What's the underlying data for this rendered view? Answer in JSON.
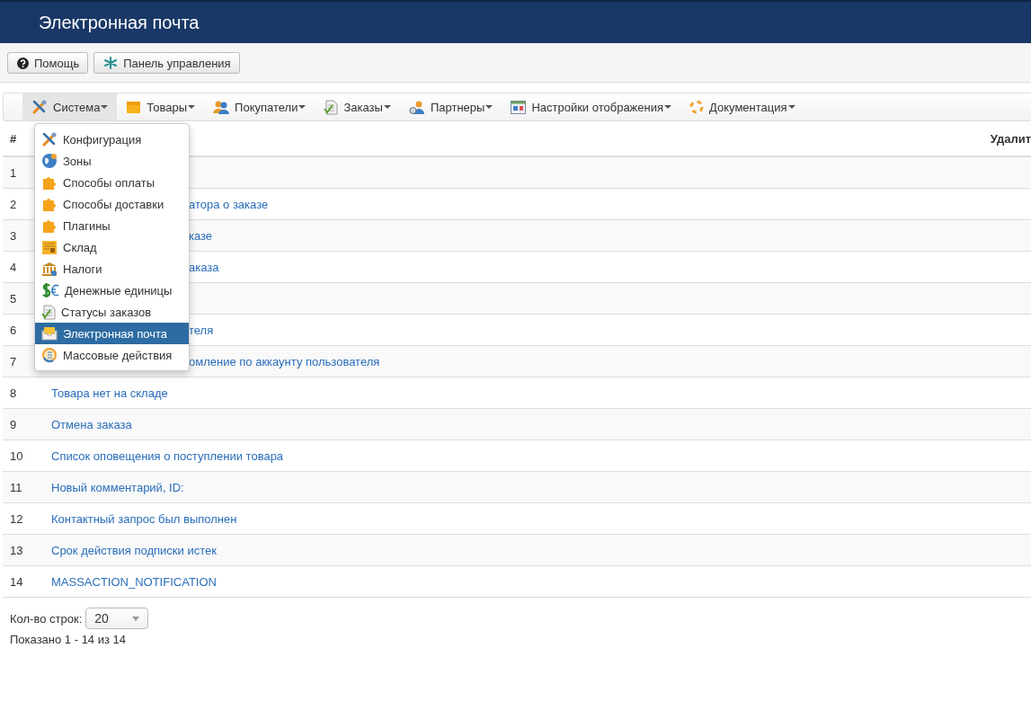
{
  "header": {
    "title": "Электронная почта"
  },
  "toolbar": [
    {
      "label": "Помощь"
    },
    {
      "label": "Панель управления"
    }
  ],
  "menu": [
    {
      "label": "Система",
      "selected": true
    },
    {
      "label": "Товары",
      "selected": false
    },
    {
      "label": "Покупатели",
      "selected": false
    },
    {
      "label": "Заказы",
      "selected": false
    },
    {
      "label": "Партнеры",
      "selected": false
    },
    {
      "label": "Настройки отображения",
      "selected": false
    },
    {
      "label": "Документация",
      "selected": false
    }
  ],
  "dropdown": [
    {
      "label": "Конфигурация",
      "selected": false
    },
    {
      "label": "Зоны",
      "selected": false
    },
    {
      "label": "Способы оплаты",
      "selected": false
    },
    {
      "label": "Способы доставки",
      "selected": false
    },
    {
      "label": "Плагины",
      "selected": false
    },
    {
      "label": "Склад",
      "selected": false
    },
    {
      "label": "Налоги",
      "selected": false
    },
    {
      "label": "Денежные единицы",
      "selected": false
    },
    {
      "label": "Статусы заказов",
      "selected": false
    },
    {
      "label": "Электронная почта",
      "selected": true
    },
    {
      "label": "Массовые действия",
      "selected": false
    }
  ],
  "table": {
    "columns": [
      "#",
      "Удалит"
    ],
    "rows": [
      {
        "number": "1"
      },
      {
        "number": "2",
        "title": "атора о заказе"
      },
      {
        "number": "3",
        "title": "казе"
      },
      {
        "number": "4",
        "title": "аказа"
      },
      {
        "number": "5"
      },
      {
        "number": "6",
        "title": "теля"
      },
      {
        "number": "7",
        "title": "омление по аккаунту пользователя"
      },
      {
        "number": "8",
        "title": "Товара нет на складе"
      },
      {
        "number": "9",
        "title": "Отмена заказа"
      },
      {
        "number": "10",
        "title": "Список оповещения о поступлении товара"
      },
      {
        "number": "11",
        "title": "Новый комментарий, ID:"
      },
      {
        "number": "12",
        "title": "Контактный запрос был выполнен"
      },
      {
        "number": "13",
        "title": "Срок действия подписки истек"
      },
      {
        "number": "14",
        "title": "MASSACTION_NOTIFICATION"
      }
    ]
  },
  "footer": {
    "rows_label": "Кол-во строк:",
    "rows_value": "20",
    "summary": "Показано 1 - 14 из 14"
  }
}
